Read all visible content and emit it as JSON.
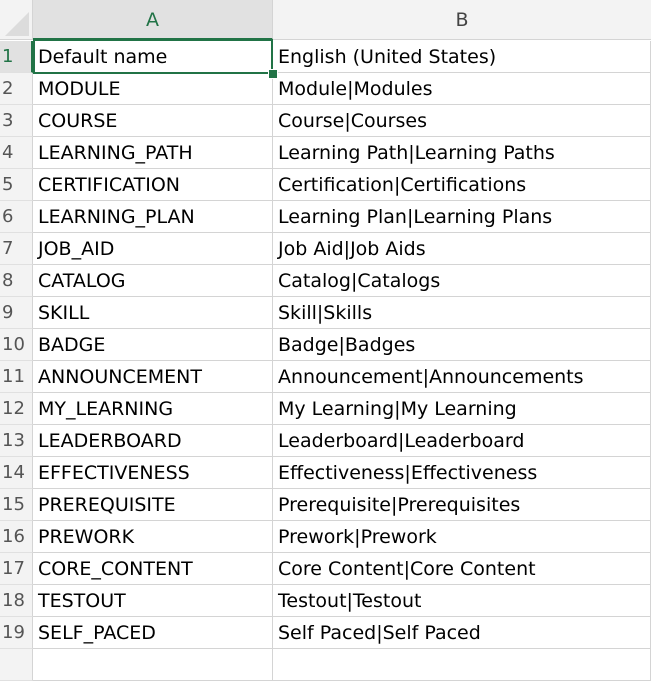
{
  "columns": [
    "A",
    "B"
  ],
  "rows": [
    [
      "Default name",
      "English (United States)"
    ],
    [
      "MODULE",
      "Module|Modules"
    ],
    [
      "COURSE",
      "Course|Courses"
    ],
    [
      "LEARNING_PATH",
      "Learning Path|Learning Paths"
    ],
    [
      "CERTIFICATION",
      "Certification|Certifications"
    ],
    [
      "LEARNING_PLAN",
      "Learning Plan|Learning Plans"
    ],
    [
      "JOB_AID",
      "Job Aid|Job Aids"
    ],
    [
      "CATALOG",
      "Catalog|Catalogs"
    ],
    [
      "SKILL",
      "Skill|Skills"
    ],
    [
      "BADGE",
      "Badge|Badges"
    ],
    [
      "ANNOUNCEMENT",
      "Announcement|Announcements"
    ],
    [
      "MY_LEARNING",
      "My Learning|My Learning"
    ],
    [
      "LEADERBOARD",
      "Leaderboard|Leaderboard"
    ],
    [
      "EFFECTIVENESS",
      "Effectiveness|Effectiveness"
    ],
    [
      "PREREQUISITE",
      "Prerequisite|Prerequisites"
    ],
    [
      "PREWORK",
      "Prework|Prework"
    ],
    [
      "CORE_CONTENT",
      "Core Content|Core Content"
    ],
    [
      "TESTOUT",
      "Testout|Testout"
    ],
    [
      "SELF_PACED",
      "Self Paced|Self Paced"
    ]
  ],
  "row_numbers": [
    "1",
    "2",
    "3",
    "4",
    "5",
    "6",
    "7",
    "8",
    "9",
    "10",
    "11",
    "12",
    "13",
    "14",
    "15",
    "16",
    "17",
    "18",
    "19"
  ],
  "selected_cell": "A1",
  "accent_color": "#217346"
}
